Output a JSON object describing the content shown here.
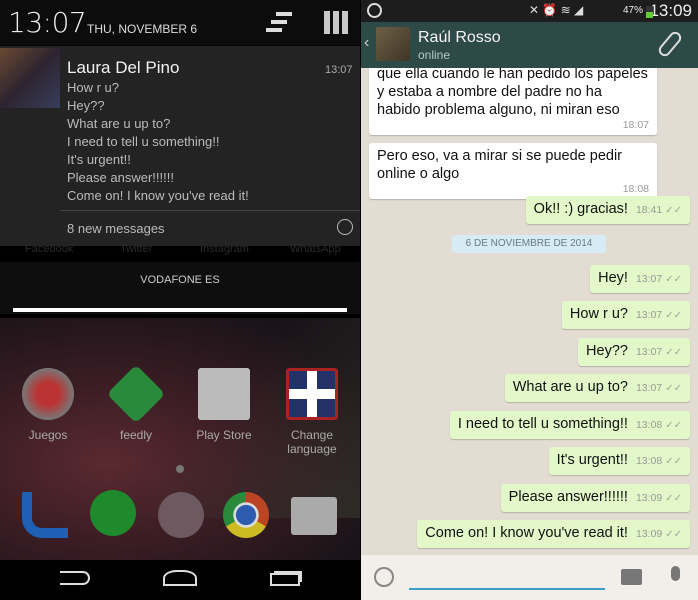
{
  "left": {
    "status": {
      "time": "13:07",
      "date": "THU, NOVEMBER 6"
    },
    "notification": {
      "sender": "Laura Del Pino",
      "time": "13:07",
      "lines": [
        "How r u?",
        "Hey??",
        "What are u up to?",
        "I need to tell u something!!",
        "It's urgent!!",
        "Please answer!!!!!!",
        "Come on! I know you've read it!"
      ],
      "summary": "8 new messages"
    },
    "faint_labels": [
      "Facebook",
      "Twitter",
      "Instagram",
      "WhatsApp"
    ],
    "carrier": "VODAFONE ES",
    "apps": [
      "Juegos",
      "feedly",
      "Play Store",
      "Change language"
    ]
  },
  "right": {
    "status": {
      "time": "13:09",
      "battery": "47%"
    },
    "contact": {
      "name": "Raúl Rosso",
      "status": "online"
    },
    "date_separator": "6 DE NOVIEMBRE DE 2014",
    "messages": [
      {
        "dir": "in",
        "text": "que ella cuando le han pedido los papeles y estaba a nombre del padre no ha habido problema alguno, ni miran eso",
        "time": "18:07"
      },
      {
        "dir": "in",
        "text": "Pero eso, va a mirar si se puede pedir online o algo",
        "time": "18:08"
      },
      {
        "dir": "out",
        "text": "Ok!! :) gracias!",
        "time": "18:41"
      },
      {
        "dir": "out",
        "text": "Hey!",
        "time": "13:07"
      },
      {
        "dir": "out",
        "text": "How r u?",
        "time": "13:07"
      },
      {
        "dir": "out",
        "text": "Hey??",
        "time": "13:07"
      },
      {
        "dir": "out",
        "text": "What are u up to?",
        "time": "13:07"
      },
      {
        "dir": "out",
        "text": "I need to tell u something!!",
        "time": "13:08"
      },
      {
        "dir": "out",
        "text": "It's urgent!!",
        "time": "13:08"
      },
      {
        "dir": "out",
        "text": "Please answer!!!!!!",
        "time": "13:09"
      },
      {
        "dir": "out",
        "text": "Come on! I know you've read it!",
        "time": "13:09"
      }
    ],
    "input": {
      "value": "",
      "placeholder": ""
    }
  },
  "colors": {
    "header": "#2e4a48",
    "chat_bg": "#e3dcd3",
    "outgoing": "#e2f8c8",
    "input_accent": "#3ba0c8"
  }
}
